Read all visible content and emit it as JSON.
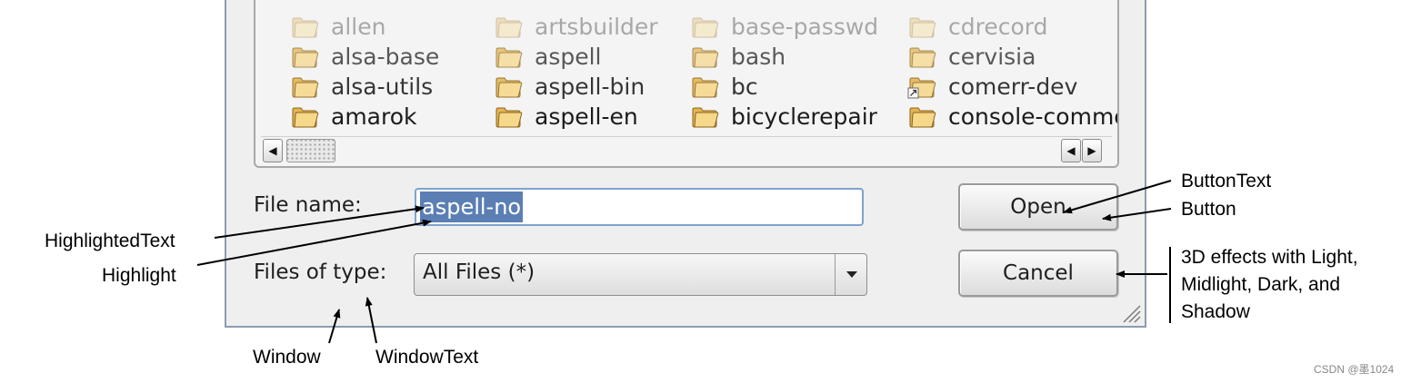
{
  "file_list": {
    "columns": [
      [
        "allen",
        "alsa-base",
        "alsa-utils",
        "amarok"
      ],
      [
        "artsbuilder",
        "aspell",
        "aspell-bin",
        "aspell-en"
      ],
      [
        "base-passwd",
        "bash",
        "bc",
        "bicyclerepair"
      ],
      [
        "cdrecord",
        "cervisia",
        "comerr-dev",
        "console-common"
      ]
    ],
    "scroll_left_arrow": "◀",
    "scroll_right_arrow": "▶"
  },
  "form": {
    "file_name_label": "File name:",
    "file_name_value": "aspell-no",
    "files_of_type_label": "Files of type:",
    "files_of_type_value": "All Files (*)"
  },
  "buttons": {
    "open": "Open",
    "cancel": "Cancel"
  },
  "annotations": {
    "highlighted_text": "HighlightedText",
    "highlight": "Highlight",
    "window": "Window",
    "window_text": "WindowText",
    "button_text": "ButtonText",
    "button": "Button",
    "effects_line1": "3D effects with Light,",
    "effects_line2": "Midlight, Dark, and",
    "effects_line3": "Shadow"
  },
  "watermark": "CSDN @墨1024",
  "colors": {
    "highlight": "#5b7fb4",
    "highlighted_text": "#ffffff",
    "window": "#efefef",
    "focus_border": "#7fa3cf"
  },
  "icons": {
    "folder": "folder-icon",
    "symlink": "folder-link-icon",
    "dropdown": "chevron-down-icon",
    "resize": "resize-grip-icon"
  }
}
